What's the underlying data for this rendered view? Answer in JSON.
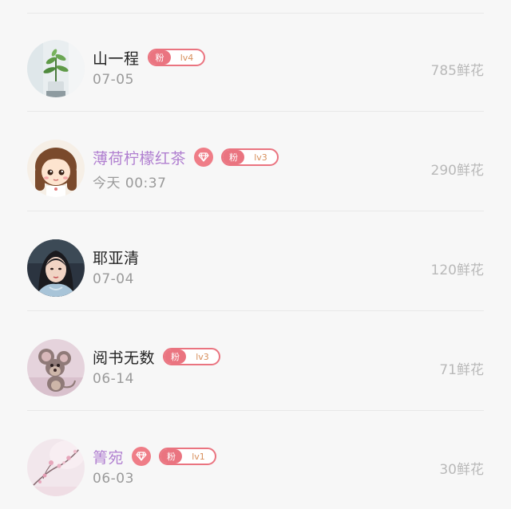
{
  "fan_badge_label": "粉",
  "accent_color": "#ea7480",
  "vip_name_color": "#b07fd0",
  "users": [
    {
      "name": "山一程",
      "vip": false,
      "diamond": false,
      "fan_level": "lv4",
      "date": "07-05",
      "flowers": "785鲜花",
      "avatar": "plant-avatar"
    },
    {
      "name": "薄荷柠檬红茶",
      "vip": true,
      "diamond": true,
      "fan_level": "lv3",
      "date": "今天 00:37",
      "flowers": "290鲜花",
      "avatar": "cartoon-girl-avatar"
    },
    {
      "name": "耶亚清",
      "vip": false,
      "diamond": false,
      "fan_level": null,
      "date": "07-04",
      "flowers": "120鲜花",
      "avatar": "woman-portrait-avatar"
    },
    {
      "name": "阅书无数",
      "vip": false,
      "diamond": false,
      "fan_level": "lv3",
      "date": "06-14",
      "flowers": "71鲜花",
      "avatar": "cartoon-mouse-avatar"
    },
    {
      "name": "箐宛",
      "vip": true,
      "diamond": true,
      "fan_level": "lv1",
      "date": "06-03",
      "flowers": "30鲜花",
      "avatar": "blossom-avatar"
    }
  ]
}
